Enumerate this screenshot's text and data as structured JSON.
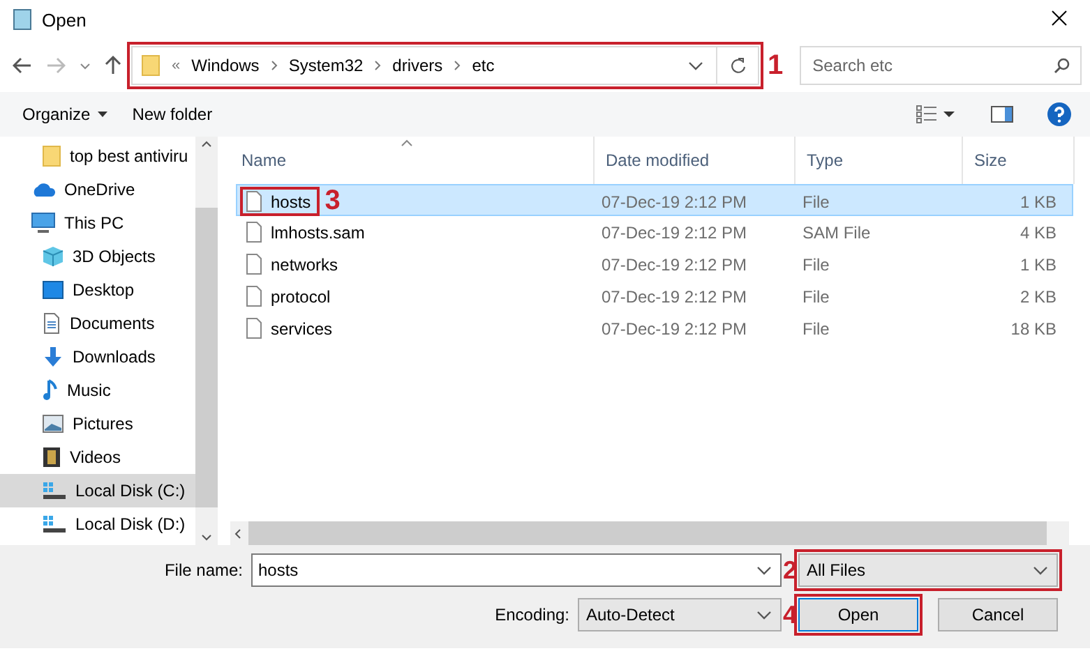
{
  "window": {
    "title": "Open"
  },
  "address": {
    "overflow": "«",
    "crumbs": [
      "Windows",
      "System32",
      "drivers",
      "etc"
    ],
    "callout": "1"
  },
  "search": {
    "placeholder": "Search etc"
  },
  "toolbar": {
    "buttons": [
      "Organize",
      "New folder"
    ]
  },
  "sidebar": {
    "items": [
      {
        "label": "top best antiviru",
        "selected": false
      },
      {
        "label": "OneDrive",
        "selected": false
      },
      {
        "label": "This PC",
        "selected": false,
        "children": [
          {
            "label": "3D Objects",
            "selected": false
          },
          {
            "label": "Desktop",
            "selected": false
          },
          {
            "label": "Documents",
            "selected": false
          },
          {
            "label": "Downloads",
            "selected": false
          },
          {
            "label": "Music",
            "selected": false
          },
          {
            "label": "Pictures",
            "selected": false
          },
          {
            "label": "Videos",
            "selected": false
          },
          {
            "label": "Local Disk (C:)",
            "selected": true
          },
          {
            "label": "Local Disk (D:)",
            "selected": false
          }
        ]
      }
    ]
  },
  "table": {
    "columns": [
      "Name",
      "Date modified",
      "Type",
      "Size"
    ],
    "rows": [
      {
        "name": "hosts",
        "date": "07-Dec-19 2:12 PM",
        "type": "File",
        "size": "1 KB",
        "selected": true,
        "callout": "3"
      },
      {
        "name": "lmhosts.sam",
        "date": "07-Dec-19 2:12 PM",
        "type": "SAM File",
        "size": "4 KB",
        "selected": false
      },
      {
        "name": "networks",
        "date": "07-Dec-19 2:12 PM",
        "type": "File",
        "size": "1 KB",
        "selected": false
      },
      {
        "name": "protocol",
        "date": "07-Dec-19 2:12 PM",
        "type": "File",
        "size": "2 KB",
        "selected": false
      },
      {
        "name": "services",
        "date": "07-Dec-19 2:12 PM",
        "type": "File",
        "size": "18 KB",
        "selected": false
      }
    ]
  },
  "footer": {
    "file_name_label": "File name:",
    "file_name": "hosts",
    "file_type": "All Files",
    "file_type_callout": "2",
    "encoding_label": "Encoding:",
    "encoding": "Auto-Detect",
    "open_button": "Open",
    "open_callout": "4",
    "cancel_button": "Cancel"
  }
}
